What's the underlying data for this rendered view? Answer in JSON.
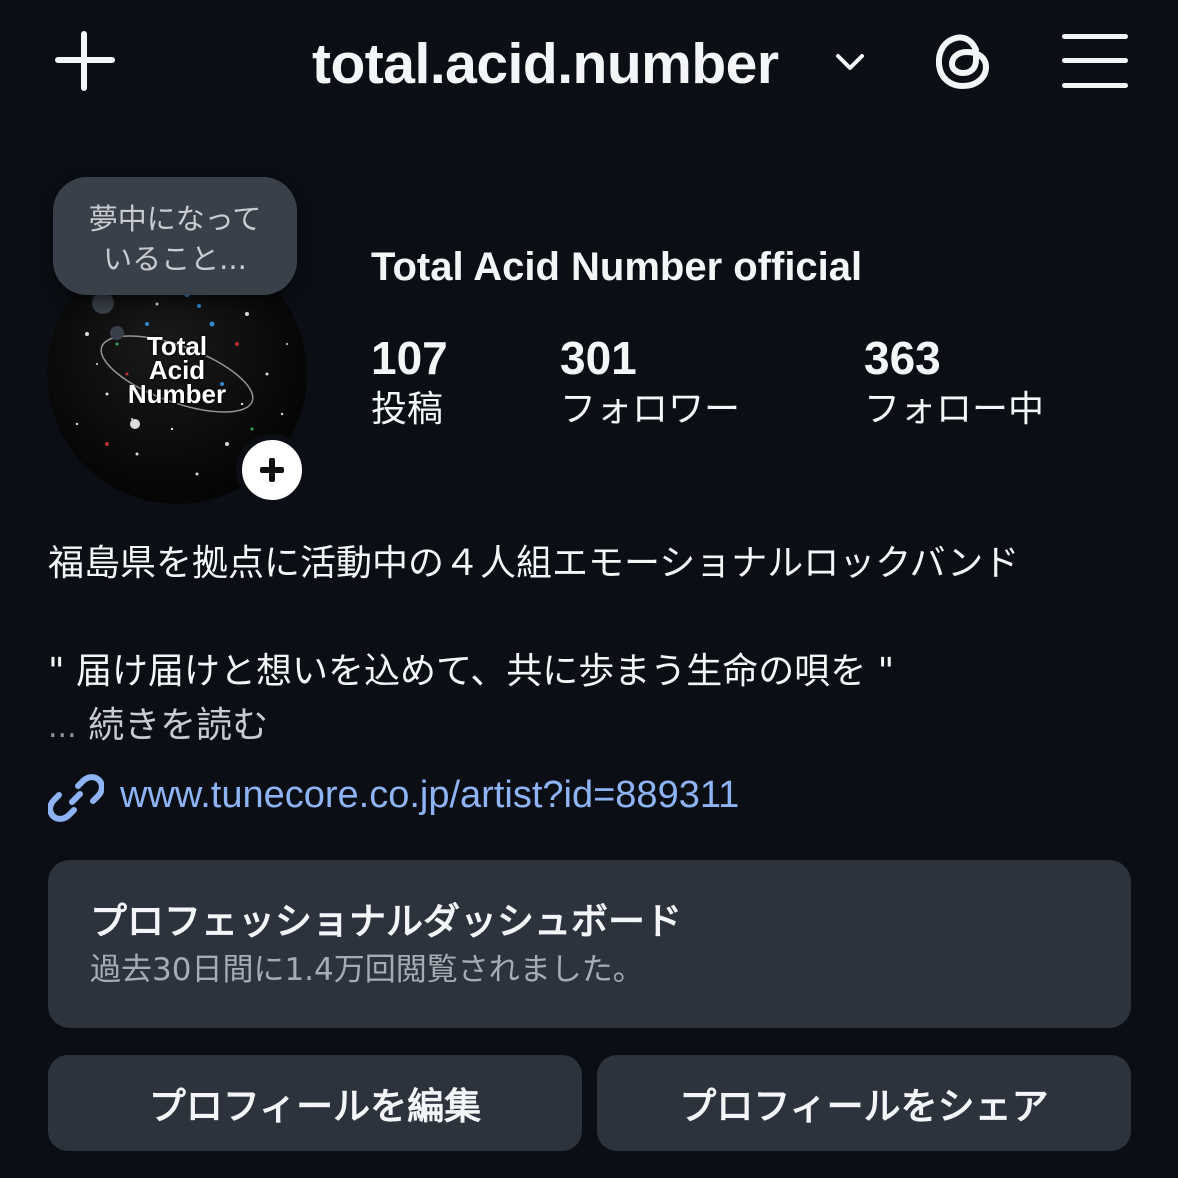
{
  "header": {
    "username": "total.acid.number",
    "icons": {
      "create": "plus-icon",
      "account_switch": "chevron-down-icon",
      "threads": "threads-icon",
      "menu": "hamburger-menu-icon"
    }
  },
  "profile": {
    "avatar_text": [
      "Total",
      "Acid",
      "Number"
    ],
    "note_placeholder": [
      "夢中になって",
      "いること..."
    ],
    "display_name": "Total Acid Number official",
    "stats": [
      {
        "value": "107",
        "label": "投稿"
      },
      {
        "value": "301",
        "label": "フォロワー"
      },
      {
        "value": "363",
        "label": "フォロー中"
      }
    ]
  },
  "bio": {
    "line1": "福島県を拠点に活動中の４人組エモーショナルロックバンド",
    "line2": "\" 届け届けと想いを込めて、共に歩まう生命の唄を \"",
    "ellipsis": "...",
    "more": "続きを読む",
    "link": "www.tunecore.co.jp/artist?id=889311"
  },
  "dashboard": {
    "title": "プロフェッショナルダッシュボード",
    "subtitle": "過去30日間に1.4万回閲覧されました。"
  },
  "buttons": {
    "edit": "プロフィールを編集",
    "share": "プロフィールをシェア"
  },
  "colors": {
    "background": "#0b0f15",
    "surface": "#2c333d",
    "link": "#8eb4f5"
  }
}
